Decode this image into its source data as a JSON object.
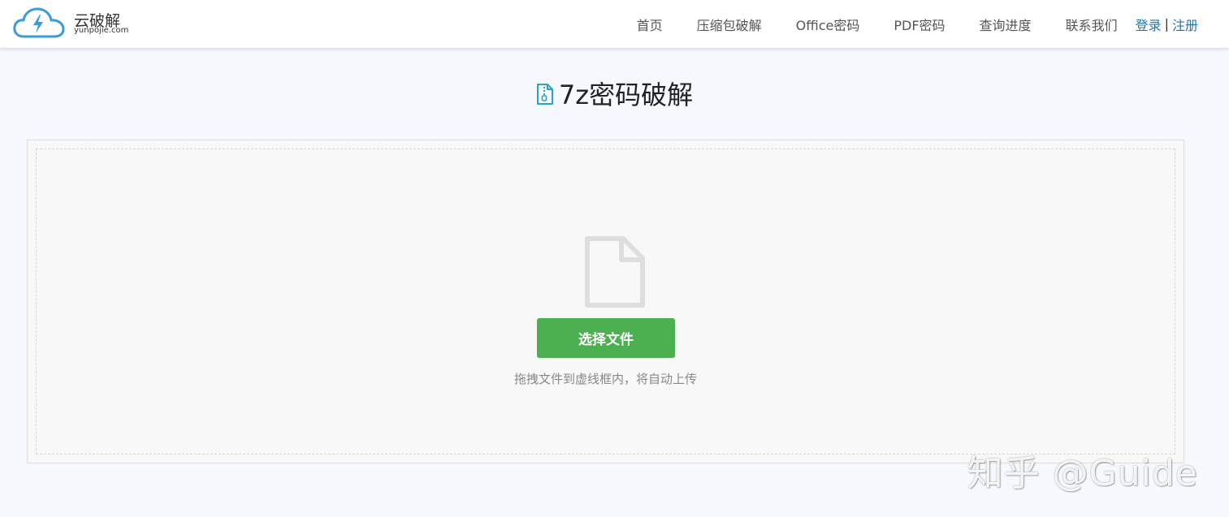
{
  "header": {
    "logo": {
      "title": "云破解",
      "subtitle": "yunpojie.com"
    },
    "nav": [
      {
        "label": "首页"
      },
      {
        "label": "压缩包破解"
      },
      {
        "label": "Office密码"
      },
      {
        "label": "PDF密码"
      },
      {
        "label": "查询进度"
      },
      {
        "label": "联系我们"
      }
    ],
    "auth": {
      "login": "登录",
      "separator": "|",
      "register": "注册"
    }
  },
  "page": {
    "title": "7z密码破解",
    "title_icon": "zip-file-icon"
  },
  "upload": {
    "icon": "file-icon",
    "button_label": "选择文件",
    "hint": "拖拽文件到虚线框内，将自动上传"
  },
  "watermark": "知乎 @Guide",
  "colors": {
    "accent_green": "#4caf50",
    "link_blue": "#1e75b5",
    "logo_blue": "#3a9bd9"
  }
}
